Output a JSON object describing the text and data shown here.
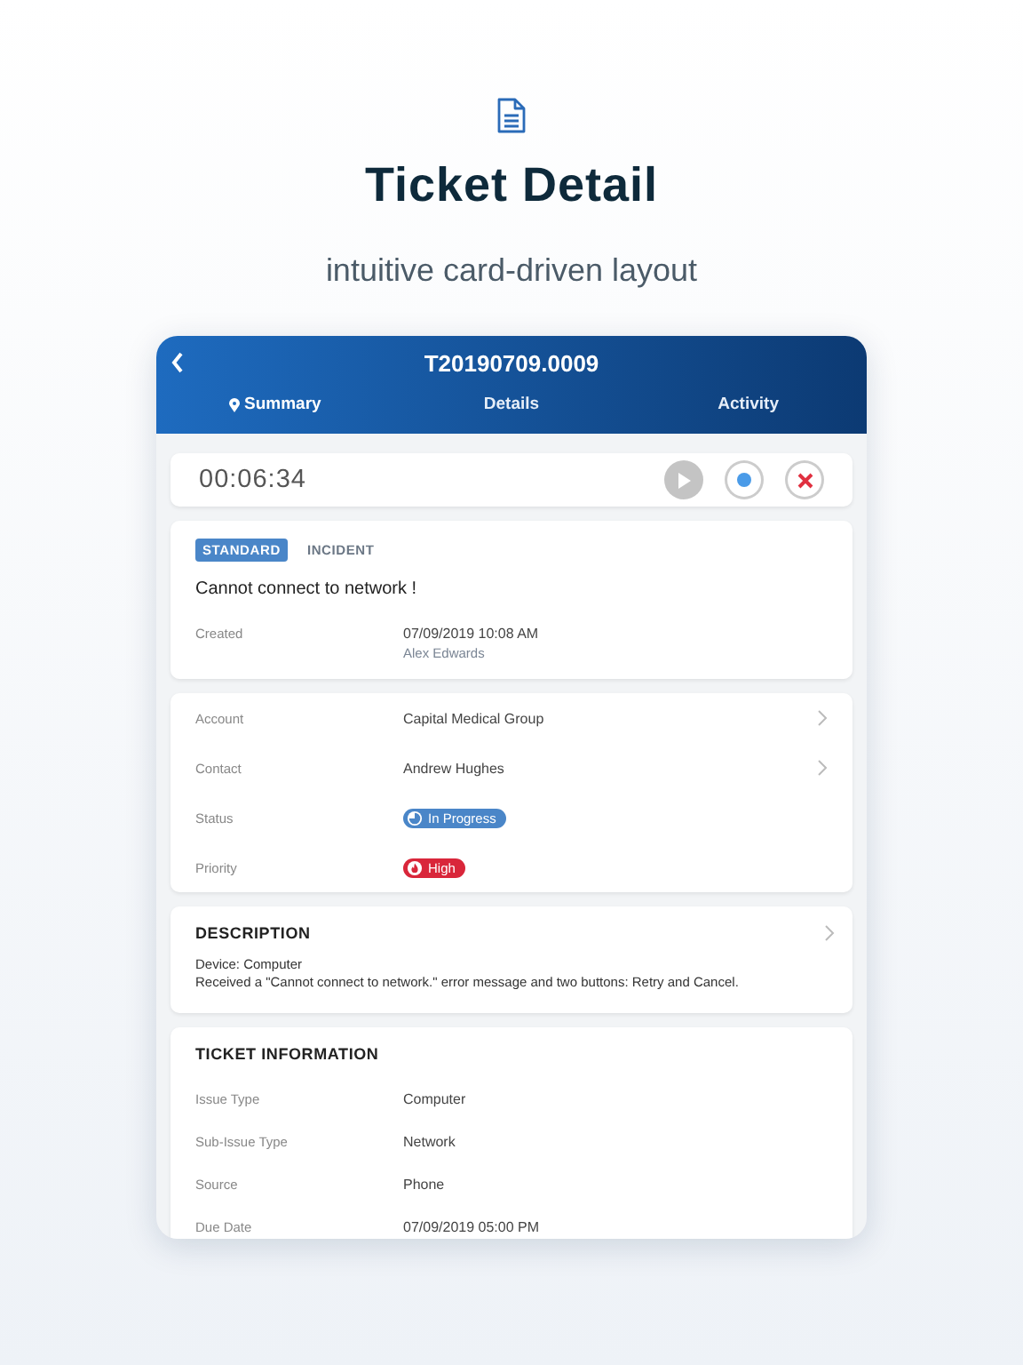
{
  "hero": {
    "title": "Ticket Detail",
    "subtitle": "intuitive card-driven layout"
  },
  "header": {
    "title": "T20190709.0009",
    "tabs": [
      {
        "label": "Summary",
        "selected": true
      },
      {
        "label": "Details",
        "selected": false
      },
      {
        "label": "Activity",
        "selected": false
      }
    ]
  },
  "timer": {
    "time": "00:06:34"
  },
  "ticket": {
    "tags": [
      {
        "label": "STANDARD",
        "kind": "filled"
      },
      {
        "label": "INCIDENT",
        "kind": "plain"
      }
    ],
    "title": "Cannot connect to network !",
    "created_label": "Created",
    "created_value": "07/09/2019 10:08 AM",
    "created_by": "Alex Edwards"
  },
  "fields": [
    {
      "label": "Account",
      "value": "Capital Medical Group",
      "kind": "link"
    },
    {
      "label": "Contact",
      "value": "Andrew Hughes",
      "kind": "link"
    },
    {
      "label": "Status",
      "value": "In Progress",
      "kind": "status",
      "color": "#4a86c8"
    },
    {
      "label": "Priority",
      "value": "High",
      "kind": "priority",
      "color": "#d9263a"
    }
  ],
  "description": {
    "heading": "DESCRIPTION",
    "lines": [
      "Device: Computer",
      "Received a \"Cannot connect to network.\" error message and two buttons: Retry and Cancel."
    ]
  },
  "ticket_information": {
    "heading": "TICKET INFORMATION",
    "rows": [
      {
        "label": "Issue Type",
        "value": "Computer"
      },
      {
        "label": "Sub-Issue Type",
        "value": "Network"
      },
      {
        "label": "Source",
        "value": "Phone"
      },
      {
        "label": "Due Date",
        "value": "07/09/2019 05:00 PM"
      }
    ]
  }
}
